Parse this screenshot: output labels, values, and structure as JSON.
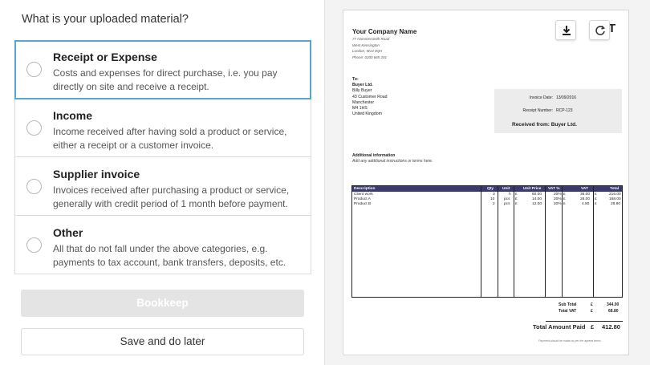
{
  "question": "What is your uploaded material?",
  "options": [
    {
      "title": "Receipt or Expense",
      "desc": "Costs and expenses for direct purchase, i.e. you pay directly on site and receive a receipt."
    },
    {
      "title": "Income",
      "desc": "Income received after having sold a product or service, either a receipt or a customer invoice."
    },
    {
      "title": "Supplier invoice",
      "desc": "Invoices received after purchasing a product or service, generally with credit period of 1 month before payment."
    },
    {
      "title": "Other",
      "desc": "All that do not fall under the above categories, e.g. payments to tax account, bank transfers, deposits, etc."
    }
  ],
  "buttons": {
    "bookkeep": "Bookkeep",
    "save": "Save and do later"
  },
  "document": {
    "company": "Your Company Name",
    "address": [
      "77 Hammersmith Road",
      "West Kensington",
      "London, W14 0QH",
      "Phone: 0200 665 201"
    ],
    "title_partial": "T",
    "to": {
      "label": "To:",
      "lines": [
        "Buyer Ltd.",
        "Billy Buyer",
        "43 Customer Road",
        "Manchester",
        "M4 1HS",
        "United Kingdom"
      ]
    },
    "invoice_date_label": "Invoice Date:",
    "invoice_date": "13/09/2016",
    "receipt_number_label": "Receipt Number:",
    "receipt_number": "RCP-123",
    "received_from": "Received from: Buyer Ltd.",
    "additional_title": "Additional information",
    "additional_text": "Add any additional instructions or terms here.",
    "table": {
      "headers": [
        "Description",
        "Qty",
        "Unit",
        "Unit Price",
        "VAT %",
        "VAT",
        "Total"
      ],
      "rows": [
        [
          "Client work",
          "3",
          "h",
          "£",
          "60.00",
          "20%",
          "£",
          "36.00",
          "£",
          "216.00"
        ],
        [
          "Product A",
          "10",
          "pcs",
          "£",
          "14.00",
          "20%",
          "£",
          "28.00",
          "£",
          "168.00"
        ],
        [
          "Product B",
          "2",
          "pcs",
          "£",
          "12.00",
          "20%",
          "£",
          "4.80",
          "£",
          "28.80"
        ]
      ]
    },
    "subtotal_label": "Sub Total",
    "subtotal_cur": "£",
    "subtotal": "344.00",
    "totalvat_label": "Total VAT",
    "totalvat_cur": "£",
    "totalvat": "68.80",
    "grand_label": "Total Amount Paid",
    "grand_cur": "£",
    "grand": "412.80",
    "note": "Payment should be made as per the agreed terms"
  },
  "icons": {
    "download": "download-icon",
    "refresh": "refresh-icon"
  },
  "colors": {
    "selected_border": "#56a7cf",
    "table_header": "#3a3a6e",
    "disabled_button": "#e4e4e4"
  }
}
